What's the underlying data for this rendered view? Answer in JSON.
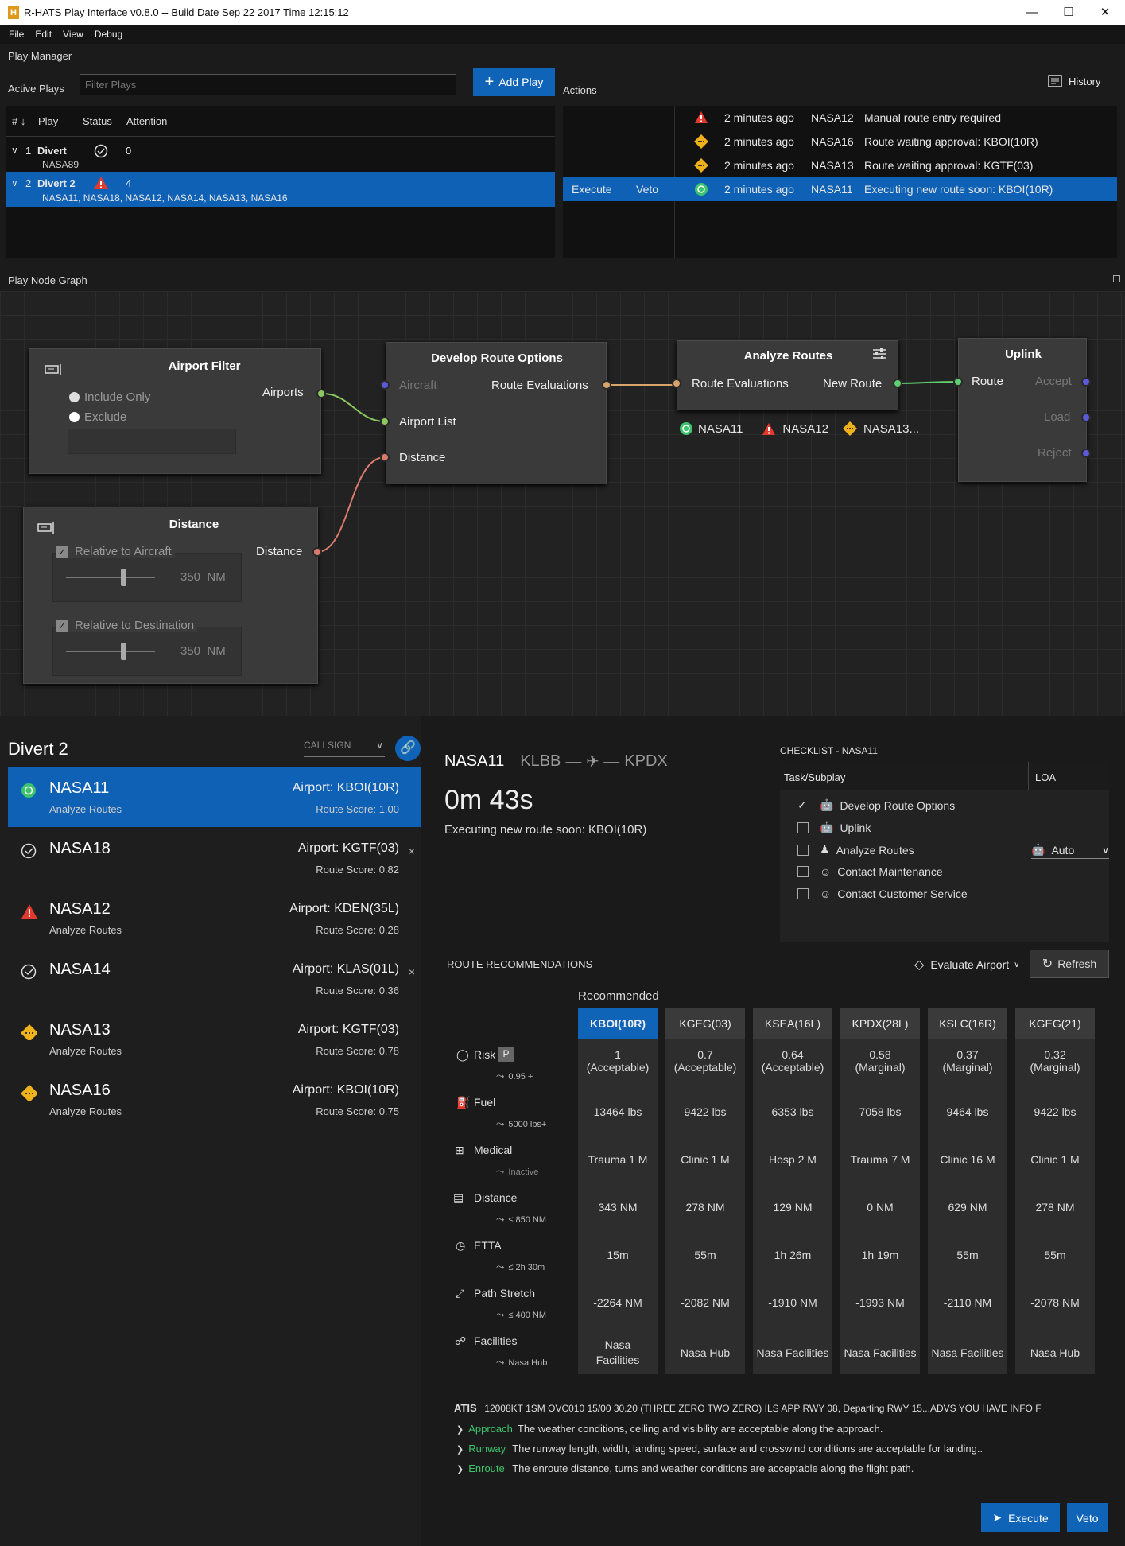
{
  "window": {
    "title": "R-HATS Play Interface v0.8.0  --  Build Date Sep 22 2017 Time 12:15:12"
  },
  "menu": [
    "File",
    "Edit",
    "View",
    "Debug"
  ],
  "play_manager": {
    "title": "Play Manager",
    "active_plays_label": "Active Plays",
    "filter_placeholder": "Filter Plays",
    "add_play_label": "Add Play",
    "columns": [
      "#",
      "Play",
      "Status",
      "Attention"
    ],
    "plays": [
      {
        "num": "1",
        "name": "Divert",
        "attention": "0",
        "aircraft": "NASA89",
        "status": "ok"
      },
      {
        "num": "2",
        "name": "Divert 2",
        "attention": "4",
        "aircraft": "NASA11, NASA18, NASA12, NASA14, NASA13, NASA16",
        "status": "warning"
      }
    ]
  },
  "actions": {
    "title": "Actions",
    "history_label": "History",
    "rows": [
      {
        "time": "2 minutes ago",
        "callsign": "NASA12",
        "message": "Manual route entry required",
        "icon": "error-triangle-icon"
      },
      {
        "time": "2 minutes ago",
        "callsign": "NASA16",
        "message": "Route waiting approval: KBOI(10R)",
        "icon": "pending-diamond-icon"
      },
      {
        "time": "2 minutes ago",
        "callsign": "NASA13",
        "message": "Route waiting approval: KGTF(03)",
        "icon": "pending-diamond-icon"
      },
      {
        "time": "2 minutes ago",
        "callsign": "NASA11",
        "message": "Executing new route soon: KBOI(10R)",
        "icon": "executing-circle-icon",
        "execute": "Execute",
        "veto": "Veto"
      }
    ]
  },
  "graph": {
    "title": "Play Node Graph",
    "airport_filter": {
      "title": "Airport Filter",
      "include_only": "Include Only",
      "exclude": "Exclude",
      "output": "Airports"
    },
    "distance": {
      "title": "Distance",
      "output": "Distance",
      "rel_aircraft": "Relative to Aircraft",
      "rel_aircraft_value": "350",
      "rel_dest": "Relative to Destination",
      "rel_dest_value": "350",
      "unit": "NM"
    },
    "develop": {
      "title": "Develop Route Options",
      "in_aircraft": "Aircraft",
      "in_airport_list": "Airport List",
      "in_distance": "Distance",
      "out": "Route Evaluations"
    },
    "analyze": {
      "title": "Analyze Routes",
      "in": "Route Evaluations",
      "out": "New Route",
      "tags": [
        "NASA11",
        "NASA12",
        "NASA13..."
      ]
    },
    "uplink": {
      "title": "Uplink",
      "in": "Route",
      "accept": "Accept",
      "load": "Load",
      "reject": "Reject"
    }
  },
  "divert": {
    "title": "Divert 2",
    "sort_label": "CALLSIGN",
    "aircraft": [
      {
        "callsign": "NASA11",
        "sub": "Analyze Routes",
        "airport": "Airport: KBOI(10R)",
        "score": "Route Score: 1.00",
        "status": "executing",
        "selected": true
      },
      {
        "callsign": "NASA18",
        "sub": "",
        "airport": "Airport: KGTF(03)",
        "score": "Route Score: 0.82",
        "status": "done",
        "close": "×"
      },
      {
        "callsign": "NASA12",
        "sub": "Analyze Routes",
        "airport": "Airport: KDEN(35L)",
        "score": "Route Score: 0.28",
        "status": "error"
      },
      {
        "callsign": "NASA14",
        "sub": "",
        "airport": "Airport: KLAS(01L)",
        "score": "Route Score: 0.36",
        "status": "done",
        "close": "×"
      },
      {
        "callsign": "NASA13",
        "sub": "Analyze Routes",
        "airport": "Airport: KGTF(03)",
        "score": "Route Score: 0.78",
        "status": "pending"
      },
      {
        "callsign": "NASA16",
        "sub": "Analyze Routes",
        "airport": "Airport: KBOI(10R)",
        "score": "Route Score: 0.75",
        "status": "pending"
      }
    ]
  },
  "detail": {
    "callsign": "NASA11",
    "origin": "KLBB",
    "dest": "KPDX",
    "timer": "0m 43s",
    "status": "Executing new route soon: KBOI(10R)"
  },
  "checklist": {
    "title": "CHECKLIST - NASA11",
    "col_task": "Task/Subplay",
    "col_loa": "LOA",
    "items": [
      {
        "label": "Develop Route Options",
        "checked": true
      },
      {
        "label": "Uplink",
        "checked": false
      },
      {
        "label": "Analyze Routes",
        "checked": false,
        "loa": "Auto"
      },
      {
        "label": "Contact Maintenance",
        "checked": false
      },
      {
        "label": "Contact Customer Service",
        "checked": false
      }
    ]
  },
  "recommendations": {
    "title": "ROUTE RECOMMENDATIONS",
    "evaluate_label": "Evaluate Airport",
    "refresh_label": "Refresh",
    "recommended_label": "Recommended",
    "criteria": [
      {
        "name": "Risk",
        "badge": "P",
        "limit": "0.95 +"
      },
      {
        "name": "Fuel",
        "limit": "5000 lbs+"
      },
      {
        "name": "Medical",
        "limit": "Inactive"
      },
      {
        "name": "Distance",
        "limit": "≤ 850 NM"
      },
      {
        "name": "ETTA",
        "limit": "≤ 2h 30m"
      },
      {
        "name": "Path Stretch",
        "limit": "≤ 400 NM"
      },
      {
        "name": "Facilities",
        "limit": "Nasa Hub"
      }
    ],
    "airports": [
      {
        "name": "KBOI(10R)",
        "risk": "1",
        "risk_label": "(Acceptable)",
        "fuel": "13464 lbs",
        "medical": "Trauma 1 M",
        "distance": "343 NM",
        "etta": "15m",
        "stretch": "-2264 NM",
        "facilities": "Nasa Facilities"
      },
      {
        "name": "KGEG(03)",
        "risk": "0.7",
        "risk_label": "(Acceptable)",
        "fuel": "9422 lbs",
        "medical": "Clinic 1 M",
        "distance": "278 NM",
        "etta": "55m",
        "stretch": "-2082 NM",
        "facilities": "Nasa Hub"
      },
      {
        "name": "KSEA(16L)",
        "risk": "0.64",
        "risk_label": "(Acceptable)",
        "fuel": "6353 lbs",
        "medical": "Hosp 2 M",
        "distance": "129 NM",
        "etta": "1h 26m",
        "stretch": "-1910 NM",
        "facilities": "Nasa Facilities"
      },
      {
        "name": "KPDX(28L)",
        "risk": "0.58",
        "risk_label": "(Marginal)",
        "fuel": "7058 lbs",
        "medical": "Trauma 7 M",
        "distance": "0 NM",
        "etta": "1h 19m",
        "stretch": "-1993 NM",
        "facilities": "Nasa Facilities"
      },
      {
        "name": "KSLC(16R)",
        "risk": "0.37",
        "risk_label": "(Marginal)",
        "fuel": "9464 lbs",
        "medical": "Clinic 16 M",
        "distance": "629 NM",
        "etta": "55m",
        "stretch": "-2110 NM",
        "facilities": "Nasa Facilities"
      },
      {
        "name": "KGEG(21)",
        "risk": "0.32",
        "risk_label": "(Marginal)",
        "fuel": "9422 lbs",
        "medical": "Clinic 1 M",
        "distance": "278 NM",
        "etta": "55m",
        "stretch": "-2078 NM",
        "facilities": "Nasa Hub"
      }
    ]
  },
  "atis": {
    "label": "ATIS",
    "text": "12008KT 1SM OVC010 15/00 30.20 (THREE ZERO TWO ZERO) ILS APP RWY 08, Departing RWY 15...ADVS YOU HAVE INFO F",
    "items": [
      {
        "key": "Approach",
        "text": "The  weather conditions, ceiling and visibility are acceptable along the approach."
      },
      {
        "key": "Runway",
        "text": "The runway length, width, landing speed, surface and crosswind conditions are acceptable for landing.."
      },
      {
        "key": "Enroute",
        "text": "The enroute distance, turns and weather conditions are acceptable along the flight path."
      }
    ]
  },
  "footer": {
    "execute_label": "Execute",
    "veto_label": "Veto"
  },
  "colors": {
    "accent": "#0f64b8",
    "ok": "#3ec46d",
    "error": "#e23a2e",
    "pending": "#f0b21a"
  }
}
